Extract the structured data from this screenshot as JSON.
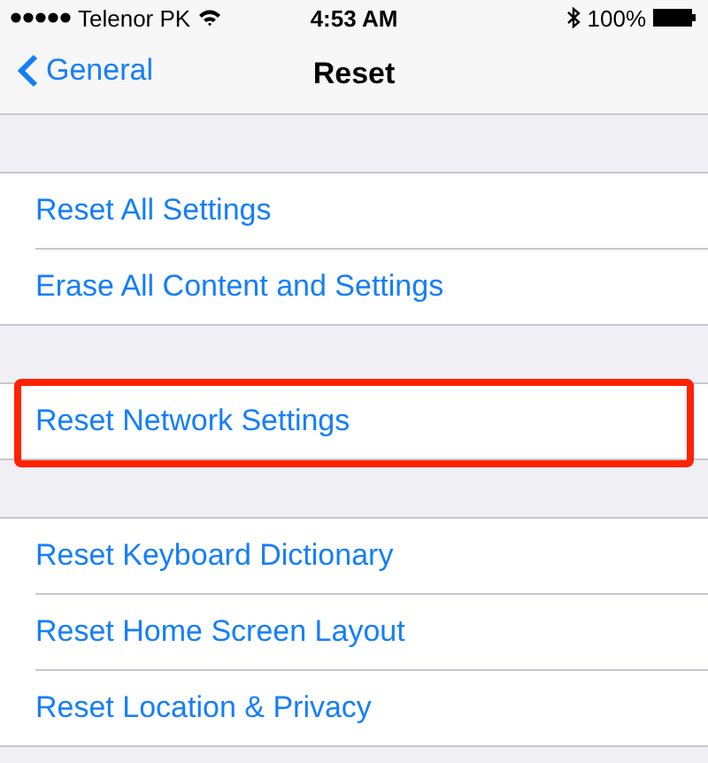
{
  "status_bar": {
    "carrier": "Telenor PK",
    "time": "4:53 AM",
    "battery": "100%"
  },
  "nav": {
    "back": "General",
    "title": "Reset"
  },
  "groups": [
    {
      "items": [
        {
          "label": "Reset All Settings",
          "highlighted": false
        },
        {
          "label": "Erase All Content and Settings",
          "highlighted": false
        }
      ]
    },
    {
      "items": [
        {
          "label": "Reset Network Settings",
          "highlighted": true
        }
      ]
    },
    {
      "items": [
        {
          "label": "Reset Keyboard Dictionary",
          "highlighted": false
        },
        {
          "label": "Reset Home Screen Layout",
          "highlighted": false
        },
        {
          "label": "Reset Location & Privacy",
          "highlighted": false
        }
      ]
    }
  ]
}
